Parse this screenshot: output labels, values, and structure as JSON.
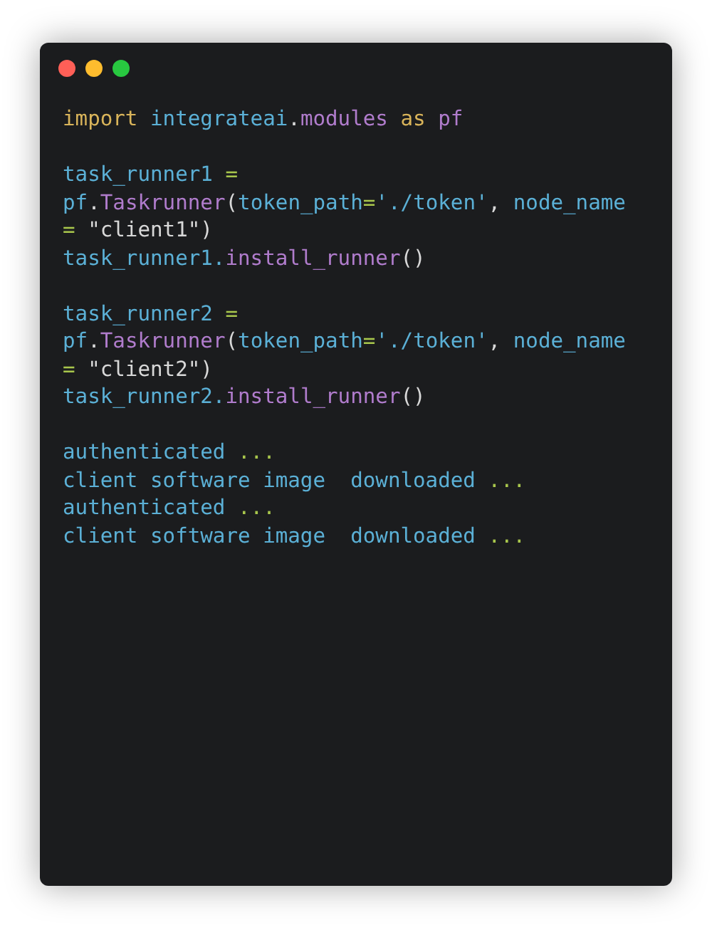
{
  "window_controls": [
    {
      "color": "#ff5f57"
    },
    {
      "color": "#febc2e"
    },
    {
      "color": "#28c840"
    }
  ],
  "code_blocks": [
    {
      "lines": [
        [
          {
            "text": "import",
            "kind": "keyword"
          },
          {
            "text": " integrateai",
            "kind": "ident"
          },
          {
            "text": ".",
            "kind": "punct"
          },
          {
            "text": "modules",
            "kind": "member"
          },
          {
            "text": " as",
            "kind": "keyword"
          },
          {
            "text": " pf",
            "kind": "member"
          }
        ]
      ]
    },
    {
      "lines": [
        [
          {
            "text": "task_runner1 ",
            "kind": "ident"
          },
          {
            "text": "=",
            "kind": "op"
          }
        ],
        [
          {
            "text": "pf",
            "kind": "ident"
          },
          {
            "text": ".",
            "kind": "punct"
          },
          {
            "text": "Taskrunner",
            "kind": "member"
          },
          {
            "text": "(",
            "kind": "punct"
          },
          {
            "text": "token_path",
            "kind": "ident"
          },
          {
            "text": "=",
            "kind": "op"
          },
          {
            "text": "'./token'",
            "kind": "ident"
          },
          {
            "text": ", ",
            "kind": "punct"
          },
          {
            "text": "node_name",
            "kind": "ident"
          }
        ],
        [
          {
            "text": "= ",
            "kind": "op"
          },
          {
            "text": "\"client1\")",
            "kind": "punct"
          }
        ],
        [
          {
            "text": "task_runner1.",
            "kind": "ident"
          },
          {
            "text": "install_runner",
            "kind": "member"
          },
          {
            "text": "()",
            "kind": "punct"
          }
        ]
      ]
    },
    {
      "lines": [
        [
          {
            "text": "task_runner2 ",
            "kind": "ident"
          },
          {
            "text": "=",
            "kind": "op"
          }
        ],
        [
          {
            "text": "pf",
            "kind": "ident"
          },
          {
            "text": ".",
            "kind": "punct"
          },
          {
            "text": "Taskrunner",
            "kind": "member"
          },
          {
            "text": "(",
            "kind": "punct"
          },
          {
            "text": "token_path",
            "kind": "ident"
          },
          {
            "text": "=",
            "kind": "op"
          },
          {
            "text": "'./token'",
            "kind": "ident"
          },
          {
            "text": ", ",
            "kind": "punct"
          },
          {
            "text": "node_name",
            "kind": "ident"
          }
        ],
        [
          {
            "text": "= ",
            "kind": "op"
          },
          {
            "text": "\"client2\")",
            "kind": "punct"
          }
        ],
        [
          {
            "text": "task_runner2.",
            "kind": "ident"
          },
          {
            "text": "install_runner",
            "kind": "member"
          },
          {
            "text": "()",
            "kind": "punct"
          }
        ]
      ]
    },
    {
      "lines": [
        [
          {
            "text": "authenticated ",
            "kind": "ident"
          },
          {
            "text": "...",
            "kind": "op"
          }
        ],
        [
          {
            "text": "client software image  downloaded ",
            "kind": "ident"
          },
          {
            "text": "...",
            "kind": "op"
          }
        ],
        [
          {
            "text": "authenticated ",
            "kind": "ident"
          },
          {
            "text": "...",
            "kind": "op"
          }
        ],
        [
          {
            "text": "client software image  downloaded ",
            "kind": "ident"
          },
          {
            "text": "...",
            "kind": "op"
          }
        ]
      ]
    }
  ]
}
